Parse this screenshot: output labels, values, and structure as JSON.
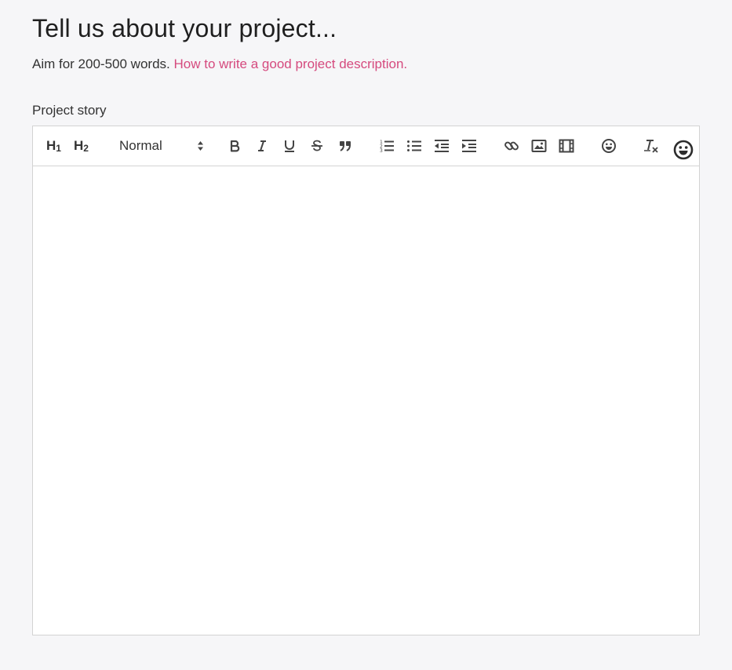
{
  "heading": "Tell us about your project...",
  "intro": {
    "text": "Aim for 200-500 words.",
    "link": "How to write a good project description."
  },
  "field_label": "Project story",
  "toolbar": {
    "h1_label": "H",
    "h1_sub": "1",
    "h2_label": "H",
    "h2_sub": "2",
    "format_select": "Normal",
    "buttons": [
      "bold-icon",
      "italic-icon",
      "underline-icon",
      "strikethrough-icon",
      "blockquote-icon",
      "ordered-list-icon",
      "bullet-list-icon",
      "outdent-icon",
      "indent-icon",
      "link-icon",
      "image-icon",
      "video-icon",
      "emoji-icon",
      "clear-format-icon"
    ]
  },
  "editor": {
    "content": ""
  },
  "colors": {
    "background": "#f6f6f8",
    "link": "#d54a7e",
    "border": "#d3d3d3",
    "icon": "#444444"
  }
}
